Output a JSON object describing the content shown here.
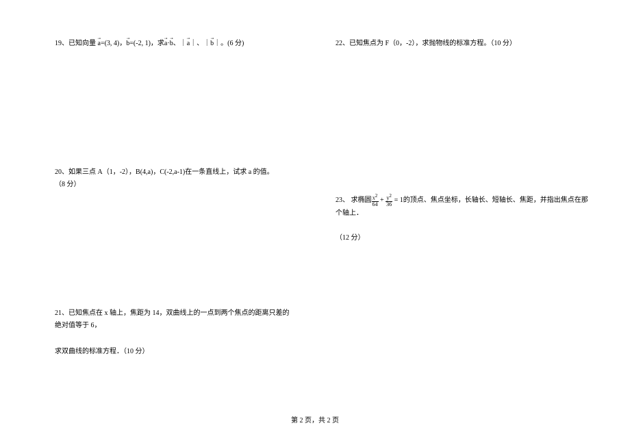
{
  "problems": {
    "p19": {
      "number": "19、",
      "prefix": "已知向量 ",
      "vec_a": "a",
      "a_val": "=(3, 4)，",
      "vec_b": "b",
      "b_val": "=(-2, 1)，求",
      "vec_a2": "a",
      "dot": "·",
      "vec_b2": "b",
      "sep1": "、｜",
      "vec_a3": "a",
      "sep2": "｜、｜",
      "vec_b3": "b",
      "sep3": "｜。",
      "points": "(6 分)"
    },
    "p20": {
      "number": "20、",
      "text": "如果三点 A（1，-2），B(4,a)，C(-2,a-1)在一条直线上，试求 a 的值。",
      "points": "（8 分）"
    },
    "p21": {
      "number": "21、",
      "line1": "已知焦点在 x 轴上，焦距为 14，双曲线上的一点到两个焦点的距离只差的绝对值等于 6，",
      "line2": "求双曲线的标准方程．",
      "points": "（10 分）"
    },
    "p22": {
      "number": "22、",
      "text": "已知焦点为 F（0，-2），求抛物线的标准方程。",
      "points": "（10 分）"
    },
    "p23": {
      "number": "23、",
      "prefix": " 求椭圆",
      "frac1_num": "x",
      "frac1_den": "64",
      "plus": " + ",
      "frac2_num": "y",
      "frac2_den": "36",
      "eq": " = 1",
      "suffix": "的顶点、焦点坐标，长轴长、短轴长、焦距，并指出焦点在那个轴上．",
      "points": "（12 分）"
    }
  },
  "footer": {
    "page_number": "第 2 页，共 2 页"
  }
}
